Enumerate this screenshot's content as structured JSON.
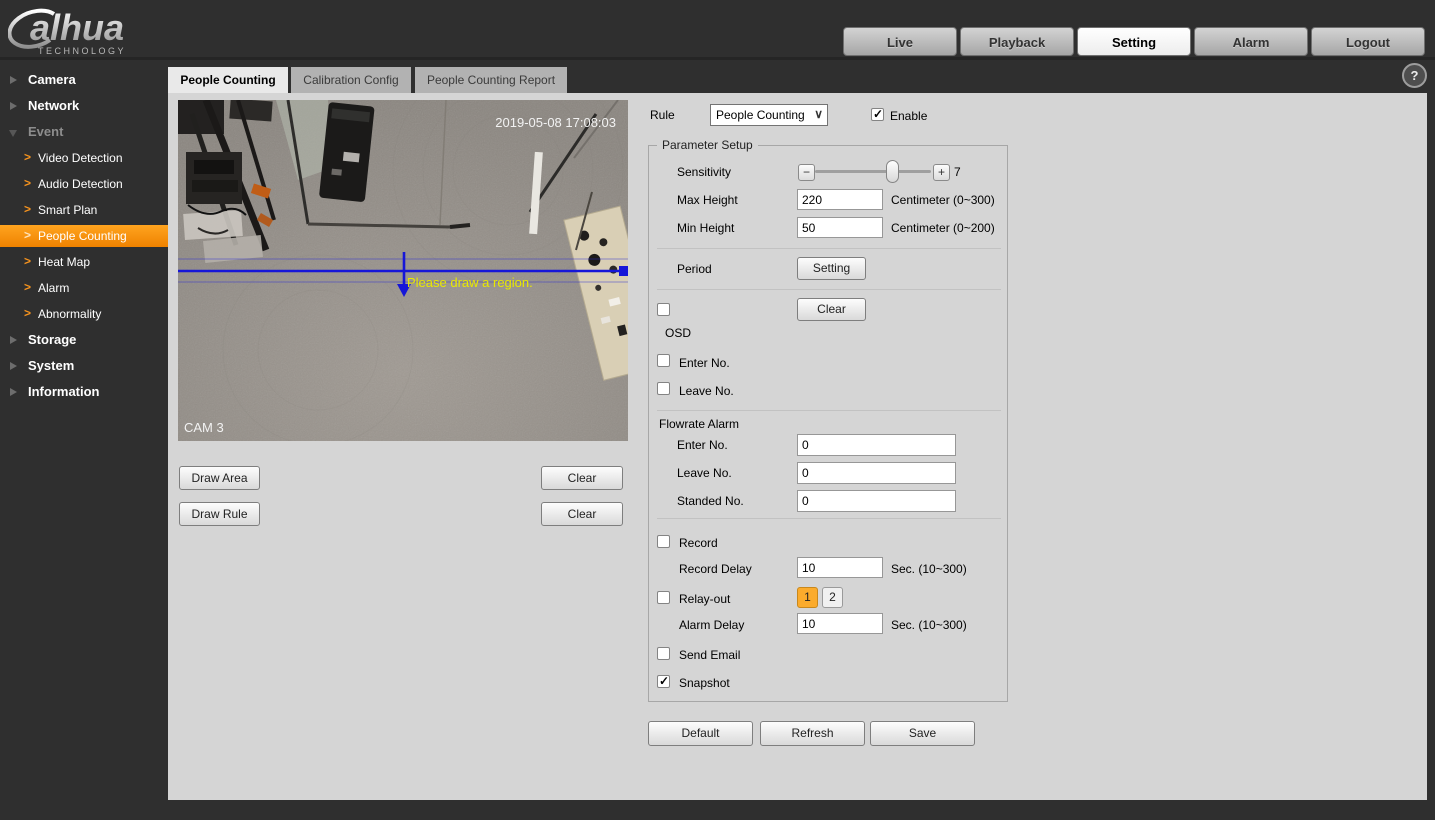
{
  "brand": {
    "name": "alhua",
    "tagline": "TECHNOLOGY"
  },
  "top_nav": {
    "items": [
      {
        "label": "Live",
        "active": false
      },
      {
        "label": "Playback",
        "active": false
      },
      {
        "label": "Setting",
        "active": true
      },
      {
        "label": "Alarm",
        "active": false
      },
      {
        "label": "Logout",
        "active": false
      }
    ]
  },
  "help_icon": "?",
  "sidebar": {
    "items": [
      {
        "label": "Camera",
        "type": "group",
        "expanded": false,
        "selected": false
      },
      {
        "label": "Network",
        "type": "group",
        "expanded": false,
        "selected": false
      },
      {
        "label": "Event",
        "type": "group",
        "expanded": true,
        "selected": false
      },
      {
        "label": "Video Detection",
        "type": "sub",
        "selected": false
      },
      {
        "label": "Audio Detection",
        "type": "sub",
        "selected": false
      },
      {
        "label": "Smart Plan",
        "type": "sub",
        "selected": false
      },
      {
        "label": "People Counting",
        "type": "sub",
        "selected": true
      },
      {
        "label": "Heat Map",
        "type": "sub",
        "selected": false
      },
      {
        "label": "Alarm",
        "type": "sub",
        "selected": false
      },
      {
        "label": "Abnormality",
        "type": "sub",
        "selected": false
      },
      {
        "label": "Storage",
        "type": "group",
        "expanded": false,
        "selected": false
      },
      {
        "label": "System",
        "type": "group",
        "expanded": false,
        "selected": false
      },
      {
        "label": "Information",
        "type": "group",
        "expanded": false,
        "selected": false
      }
    ]
  },
  "tabs": [
    {
      "label": "People Counting",
      "active": true
    },
    {
      "label": "Calibration Config",
      "active": false
    },
    {
      "label": "People Counting Report",
      "active": false
    }
  ],
  "video": {
    "timestamp": "2019-05-08 17:08:03",
    "camera_label": "CAM 3",
    "hint": "Please draw a region."
  },
  "draw_controls": {
    "draw_area": "Draw Area",
    "clear_area": "Clear",
    "draw_rule": "Draw Rule",
    "clear_rule": "Clear"
  },
  "rule": {
    "label": "Rule",
    "selected_option": "People Counting",
    "dropdown_chevron": "∨",
    "enable": {
      "label": "Enable",
      "checked": true
    }
  },
  "parameter_setup": {
    "legend": "Parameter Setup",
    "sensitivity": {
      "label": "Sensitivity",
      "value": "7",
      "minus_button": "−",
      "plus_button": "+"
    },
    "max_height": {
      "label": "Max Height",
      "value": "220",
      "unit": "Centimeter (0~300)"
    },
    "min_height": {
      "label": "Min Height",
      "value": "50",
      "unit": "Centimeter (0~200)"
    },
    "period": {
      "label": "Period",
      "button": "Setting"
    },
    "osd": {
      "label": "OSD",
      "checked": false,
      "clear_button": "Clear"
    },
    "osd_enter": {
      "label": "Enter No.",
      "checked": false
    },
    "osd_leave": {
      "label": "Leave No.",
      "checked": false
    },
    "flowrate": {
      "title": "Flowrate Alarm",
      "enter": {
        "label": "Enter No.",
        "value": "0"
      },
      "leave": {
        "label": "Leave No.",
        "value": "0"
      },
      "standed": {
        "label": "Standed No.",
        "value": "0"
      }
    },
    "record": {
      "label": "Record",
      "checked": false
    },
    "record_delay": {
      "label": "Record Delay",
      "value": "10",
      "unit": "Sec. (10~300)"
    },
    "relay_out": {
      "label": "Relay-out",
      "checked": false,
      "channels": [
        {
          "label": "1",
          "active": true
        },
        {
          "label": "2",
          "active": false
        }
      ]
    },
    "alarm_delay": {
      "label": "Alarm Delay",
      "value": "10",
      "unit": "Sec. (10~300)"
    },
    "send_email": {
      "label": "Send Email",
      "checked": false
    },
    "snapshot": {
      "label": "Snapshot",
      "checked": true
    }
  },
  "actions": {
    "default": "Default",
    "refresh": "Refresh",
    "save": "Save"
  },
  "colors": {
    "accent_orange": "#f7941e",
    "relay_active": "#fbab2c",
    "dark_bg": "#2f2f2f",
    "content_bg": "#d5d5d5",
    "rule_line_blue": "#1616d8",
    "hint_yellow": "#e9e900"
  }
}
